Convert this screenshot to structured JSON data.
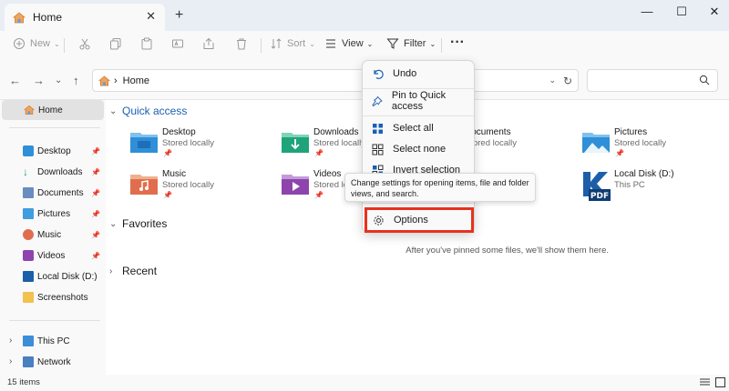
{
  "titlebar": {
    "tab_title": "Home",
    "tab_close": "✕",
    "new_tab": "+",
    "minimize": "—",
    "maximize": "☐",
    "close": "✕"
  },
  "commandbar": {
    "new_label": "New",
    "sort_label": "Sort",
    "view_label": "View",
    "filter_label": "Filter",
    "more_label": "···"
  },
  "address": {
    "path_sep": "›",
    "location": "Home"
  },
  "sidebar": {
    "home": "Home",
    "items": [
      {
        "label": "Desktop",
        "pinned": true,
        "icon": "desktop-icon"
      },
      {
        "label": "Downloads",
        "pinned": true,
        "icon": "download-icon"
      },
      {
        "label": "Documents",
        "pinned": true,
        "icon": "documents-icon"
      },
      {
        "label": "Pictures",
        "pinned": true,
        "icon": "pictures-icon"
      },
      {
        "label": "Music",
        "pinned": true,
        "icon": "music-icon"
      },
      {
        "label": "Videos",
        "pinned": true,
        "icon": "videos-icon"
      },
      {
        "label": "Local Disk (D:)",
        "pinned": false,
        "icon": "disk-icon"
      },
      {
        "label": "Screenshots",
        "pinned": false,
        "icon": "folder-icon"
      }
    ],
    "this_pc": "This PC",
    "network": "Network",
    "pin_glyph": "📌",
    "chevron": "›"
  },
  "main": {
    "quick_access": "Quick access",
    "favorites": "Favorites",
    "recent": "Recent",
    "favorites_empty": "After you've pinned some files, we'll show them here.",
    "folders": [
      {
        "name": "Desktop",
        "sub": "Stored locally",
        "color": "#2f8fd8"
      },
      {
        "name": "Downloads",
        "sub": "Stored locally",
        "color": "#1fa37a"
      },
      {
        "name": "Documents",
        "sub": "Stored locally",
        "color": "#6b8cbf"
      },
      {
        "name": "Pictures",
        "sub": "Stored locally",
        "color": "#2f8fd8"
      },
      {
        "name": "Music",
        "sub": "Stored locally",
        "color": "#e06e4e"
      },
      {
        "name": "Videos",
        "sub": "Stored locally",
        "color": "#8e44ad"
      },
      {
        "name": "Local Disk (D:)",
        "sub": "This PC",
        "color": "#1c5fa8"
      }
    ],
    "chevron_down": "⌄",
    "chevron_right": "›"
  },
  "menu": {
    "undo": "Undo",
    "pin": "Pin to Quick access",
    "select_all": "Select all",
    "select_none": "Select none",
    "invert": "Invert selection",
    "options": "Options"
  },
  "tooltip": {
    "text": "Change settings for opening items, file and folder views, and search."
  },
  "status": {
    "count": "15 items"
  },
  "colors": {
    "accent": "#1a5fb4",
    "highlight": "#e8311e"
  }
}
